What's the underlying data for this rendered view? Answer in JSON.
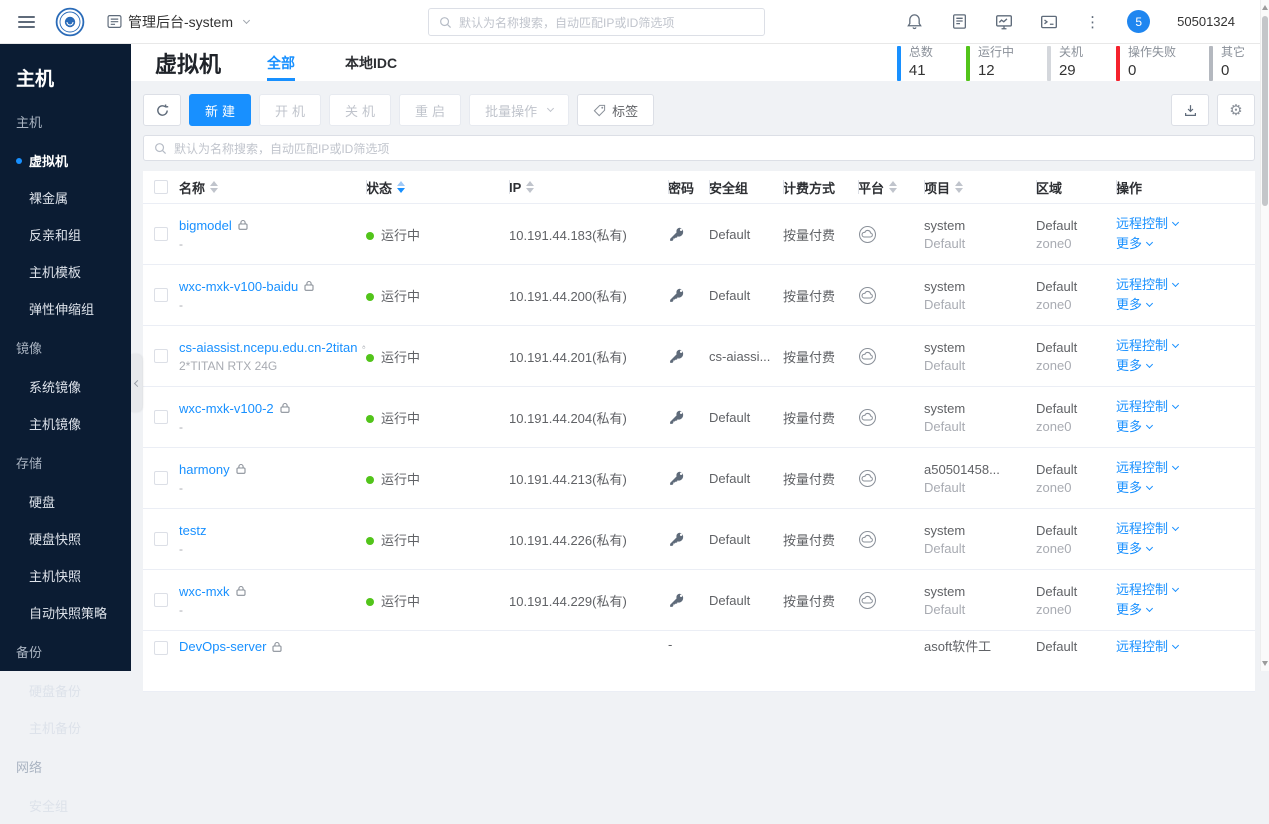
{
  "colors": {
    "accent": "#1890ff",
    "running_green": "#52c41a",
    "fail_red": "#f5222d",
    "sidebar_bg": "#0b1c33"
  },
  "topbar": {
    "workspace": "管理后台-system",
    "search_placeholder": "默认为名称搜索，自动匹配IP或ID筛选项",
    "badge_count": "5",
    "username": "50501324"
  },
  "sidebar": {
    "title": "主机",
    "groups": [
      {
        "label": "主机",
        "items": [
          {
            "label": "虚拟机",
            "active": true
          },
          {
            "label": "裸金属",
            "active": false
          },
          {
            "label": "反亲和组",
            "active": false
          },
          {
            "label": "主机模板",
            "active": false
          },
          {
            "label": "弹性伸缩组",
            "active": false
          }
        ]
      },
      {
        "label": "镜像",
        "items": [
          {
            "label": "系统镜像",
            "active": false
          },
          {
            "label": "主机镜像",
            "active": false
          }
        ]
      },
      {
        "label": "存储",
        "items": [
          {
            "label": "硬盘",
            "active": false
          },
          {
            "label": "硬盘快照",
            "active": false
          },
          {
            "label": "主机快照",
            "active": false
          },
          {
            "label": "自动快照策略",
            "active": false
          }
        ]
      },
      {
        "label": "备份",
        "items": [
          {
            "label": "硬盘备份",
            "active": false
          },
          {
            "label": "主机备份",
            "active": false
          }
        ]
      },
      {
        "label": "网络",
        "items": [
          {
            "label": "安全组",
            "active": false
          }
        ]
      }
    ]
  },
  "page": {
    "title": "虚拟机",
    "tabs": [
      {
        "label": "全部",
        "active": true
      },
      {
        "label": "本地IDC",
        "active": false
      }
    ],
    "stats": [
      {
        "label": "总数",
        "value": "41",
        "color": "#1890ff"
      },
      {
        "label": "运行中",
        "value": "12",
        "color": "#52c41a"
      },
      {
        "label": "关机",
        "value": "29",
        "color": "#d4d7dc"
      },
      {
        "label": "操作失败",
        "value": "0",
        "color": "#f5222d"
      },
      {
        "label": "其它",
        "value": "0",
        "color": "#b4b8bf"
      }
    ],
    "toolbar": {
      "create": "新建",
      "power_on": "开机",
      "power_off": "关机",
      "restart": "重启",
      "batch": "批量操作",
      "tag": "标签"
    },
    "filter_placeholder": "默认为名称搜索，自动匹配IP或ID筛选项"
  },
  "table": {
    "columns": [
      {
        "label": "名称",
        "sortable": true,
        "sorted": false
      },
      {
        "label": "状态",
        "sortable": true,
        "sorted": true
      },
      {
        "label": "IP",
        "sortable": true,
        "sorted": false
      },
      {
        "label": "密码",
        "sortable": false,
        "sorted": false
      },
      {
        "label": "安全组",
        "sortable": false,
        "sorted": false
      },
      {
        "label": "计费方式",
        "sortable": false,
        "sorted": false
      },
      {
        "label": "平台",
        "sortable": true,
        "sorted": false
      },
      {
        "label": "项目",
        "sortable": true,
        "sorted": false
      },
      {
        "label": "区域",
        "sortable": false,
        "sorted": false
      },
      {
        "label": "操作",
        "sortable": false,
        "sorted": false
      }
    ],
    "status_running": "运行中",
    "action_remote": "远程控制",
    "action_more": "更多",
    "rows": [
      {
        "name": "bigmodel",
        "lock": true,
        "sub": "-",
        "status": "运行中",
        "ip": "10.191.44.183(私有)",
        "password": "key",
        "secgroup": "Default",
        "billing": "按量付费",
        "platform": true,
        "project": "system",
        "project_sub": "Default",
        "region": "Default",
        "region_sub": "zone0",
        "actions": [
          "远程控制",
          "更多"
        ],
        "partial": false
      },
      {
        "name": "wxc-mxk-v100-baidu",
        "lock": true,
        "sub": "-",
        "status": "运行中",
        "ip": "10.191.44.200(私有)",
        "password": "key",
        "secgroup": "Default",
        "billing": "按量付费",
        "platform": true,
        "project": "system",
        "project_sub": "Default",
        "region": "Default",
        "region_sub": "zone0",
        "actions": [
          "远程控制",
          "更多"
        ],
        "partial": false
      },
      {
        "name": "cs-aiassist.ncepu.edu.cn-2titan",
        "lock": true,
        "sub": "2*TITAN RTX 24G",
        "status": "运行中",
        "ip": "10.191.44.201(私有)",
        "password": "key",
        "secgroup": "cs-aiassi...",
        "billing": "按量付费",
        "platform": true,
        "project": "system",
        "project_sub": "Default",
        "region": "Default",
        "region_sub": "zone0",
        "actions": [
          "远程控制",
          "更多"
        ],
        "partial": false
      },
      {
        "name": "wxc-mxk-v100-2",
        "lock": true,
        "sub": "-",
        "status": "运行中",
        "ip": "10.191.44.204(私有)",
        "password": "key",
        "secgroup": "Default",
        "billing": "按量付费",
        "platform": true,
        "project": "system",
        "project_sub": "Default",
        "region": "Default",
        "region_sub": "zone0",
        "actions": [
          "远程控制",
          "更多"
        ],
        "partial": false
      },
      {
        "name": "harmony",
        "lock": true,
        "sub": "-",
        "status": "运行中",
        "ip": "10.191.44.213(私有)",
        "password": "key",
        "secgroup": "Default",
        "billing": "按量付费",
        "platform": true,
        "project": "a50501458...",
        "project_sub": "Default",
        "region": "Default",
        "region_sub": "zone0",
        "actions": [
          "远程控制",
          "更多"
        ],
        "partial": false
      },
      {
        "name": "testz",
        "lock": false,
        "sub": "-",
        "status": "运行中",
        "ip": "10.191.44.226(私有)",
        "password": "key",
        "secgroup": "Default",
        "billing": "按量付费",
        "platform": true,
        "project": "system",
        "project_sub": "Default",
        "region": "Default",
        "region_sub": "zone0",
        "actions": [
          "远程控制",
          "更多"
        ],
        "partial": false
      },
      {
        "name": "wxc-mxk",
        "lock": true,
        "sub": "-",
        "status": "运行中",
        "ip": "10.191.44.229(私有)",
        "password": "key",
        "secgroup": "Default",
        "billing": "按量付费",
        "platform": true,
        "project": "system",
        "project_sub": "Default",
        "region": "Default",
        "region_sub": "zone0",
        "actions": [
          "远程控制",
          "更多"
        ],
        "partial": false
      },
      {
        "name": "DevOps-server",
        "lock": true,
        "sub": "",
        "status": "",
        "ip": "",
        "password": "dash",
        "secgroup": "",
        "billing": "",
        "platform": false,
        "project": "asoft软件工",
        "project_sub": "",
        "region": "Default",
        "region_sub": "",
        "actions": [
          "远程控制"
        ],
        "partial": true
      }
    ]
  }
}
